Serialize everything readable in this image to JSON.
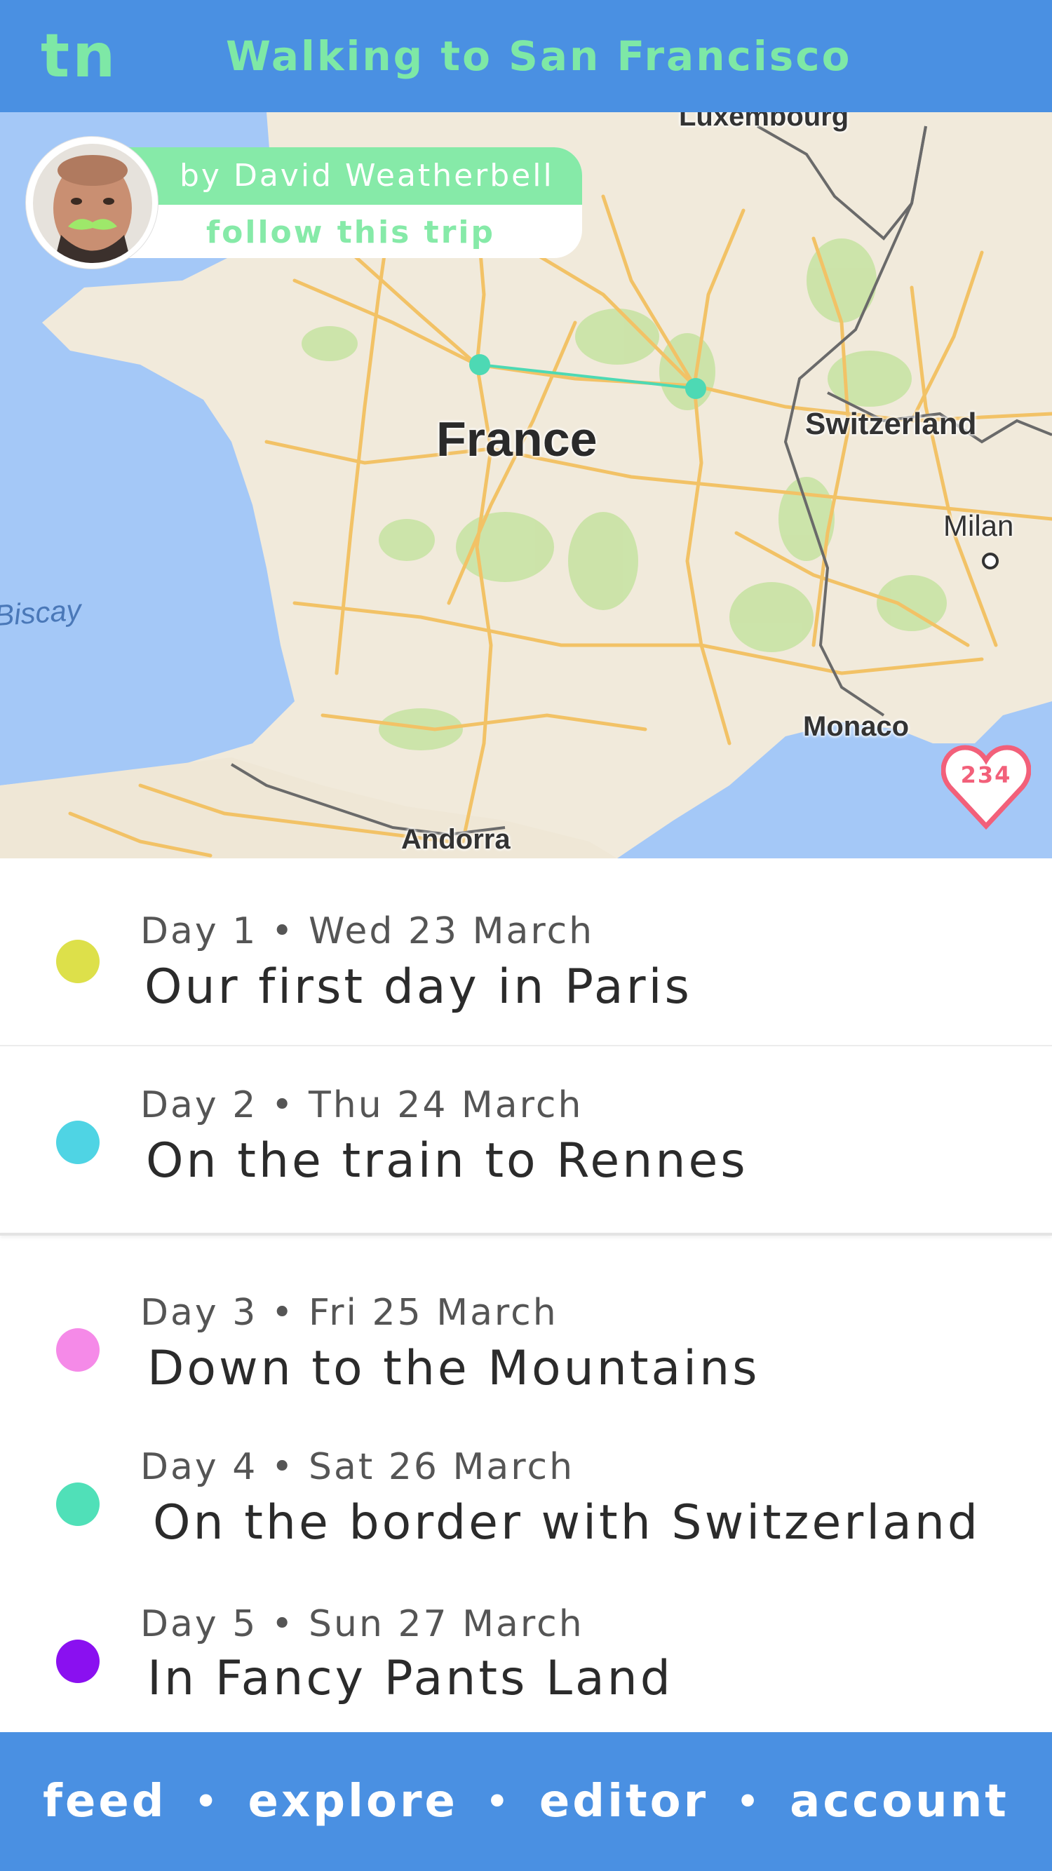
{
  "header": {
    "logo": "tn",
    "title": "Walking to San Francisco"
  },
  "author": {
    "byline": "by David Weatherbell",
    "follow_label": "follow this trip"
  },
  "map": {
    "labels": {
      "country": "France",
      "switzerland": "Switzerland",
      "milan": "Milan",
      "monaco": "Monaco",
      "andorra": "Andorra",
      "luxembourg": "Luxembourg",
      "biscay": "Biscay"
    },
    "likes": "234",
    "route_color": "#4dd9b4"
  },
  "days": [
    {
      "meta": "Day 1 • Wed 23 March",
      "title": "Our first day in Paris",
      "color": "#dde04a"
    },
    {
      "meta": "Day 2 • Thu 24 March",
      "title": "On the train to Rennes",
      "color": "#4fd4e4"
    },
    {
      "meta": "Day 3 • Fri 25 March",
      "title": "Down to the Mountains",
      "color": "#f58ae8"
    },
    {
      "meta": "Day 4 • Sat 26 March",
      "title": "On the border with Switzerland",
      "color": "#50e0b8"
    },
    {
      "meta": "Day 5 • Sun 27 March",
      "title": "In Fancy Pants Land",
      "color": "#8a10f0"
    }
  ],
  "nav": {
    "feed": "feed",
    "explore": "explore",
    "editor": "editor",
    "account": "account",
    "separator": "•"
  },
  "colors": {
    "brand_blue": "#4a90e2",
    "accent_green": "#7ee8a6",
    "heart_pink": "#f2607a"
  }
}
